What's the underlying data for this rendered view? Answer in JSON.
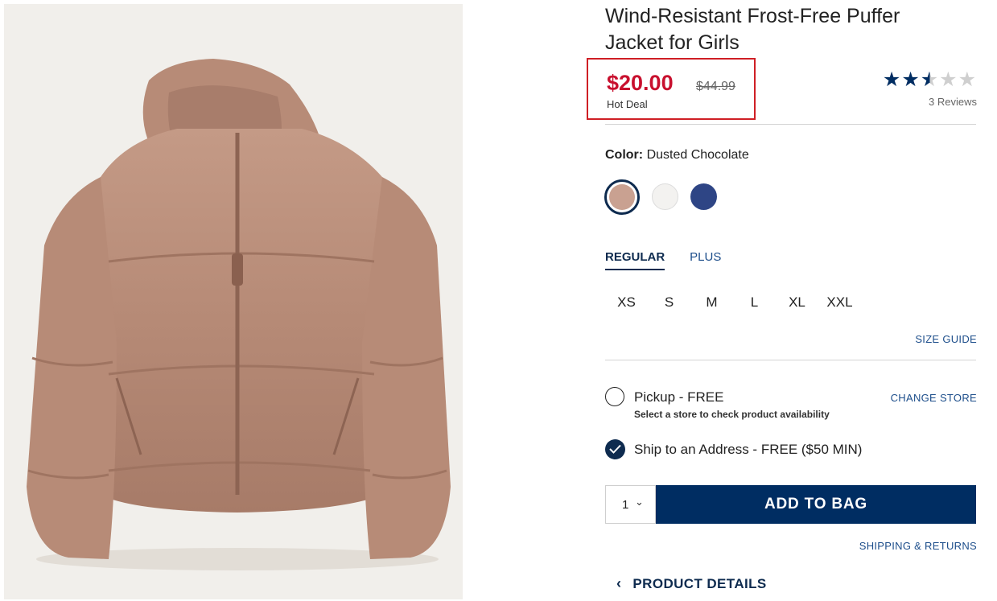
{
  "product": {
    "title": "Wind-Resistant Frost-Free Puffer Jacket for Girls",
    "price_now": "$20.00",
    "price_was": "$44.99",
    "price_tag": "Hot Deal",
    "rating": 2.5,
    "reviews": "3 Reviews"
  },
  "color": {
    "label": "Color:",
    "value": "Dusted Chocolate",
    "swatches": [
      {
        "name": "Dusted Chocolate",
        "hex": "#c9a191",
        "selected": true
      },
      {
        "name": "White",
        "hex": "#f3f2f0",
        "selected": false
      },
      {
        "name": "Navy",
        "hex": "#2e4585",
        "selected": false
      }
    ]
  },
  "fit_tabs": [
    {
      "label": "REGULAR",
      "active": true
    },
    {
      "label": "PLUS",
      "active": false
    }
  ],
  "sizes": [
    "XS",
    "S",
    "M",
    "L",
    "XL",
    "XXL"
  ],
  "size_guide": "SIZE GUIDE",
  "pickup": {
    "label": "Pickup - FREE",
    "sub": "Select a store to check product availability",
    "change_store": "CHANGE STORE"
  },
  "ship": {
    "label": "Ship to an Address - FREE ($50 MIN)"
  },
  "cart": {
    "qty": "1",
    "add_label": "ADD TO BAG"
  },
  "shipping_returns": "SHIPPING & RETURNS",
  "product_details": "PRODUCT DETAILS",
  "colors": {
    "sale_red": "#c8102e",
    "navy": "#002d62",
    "link_blue": "#1d4e8b"
  }
}
